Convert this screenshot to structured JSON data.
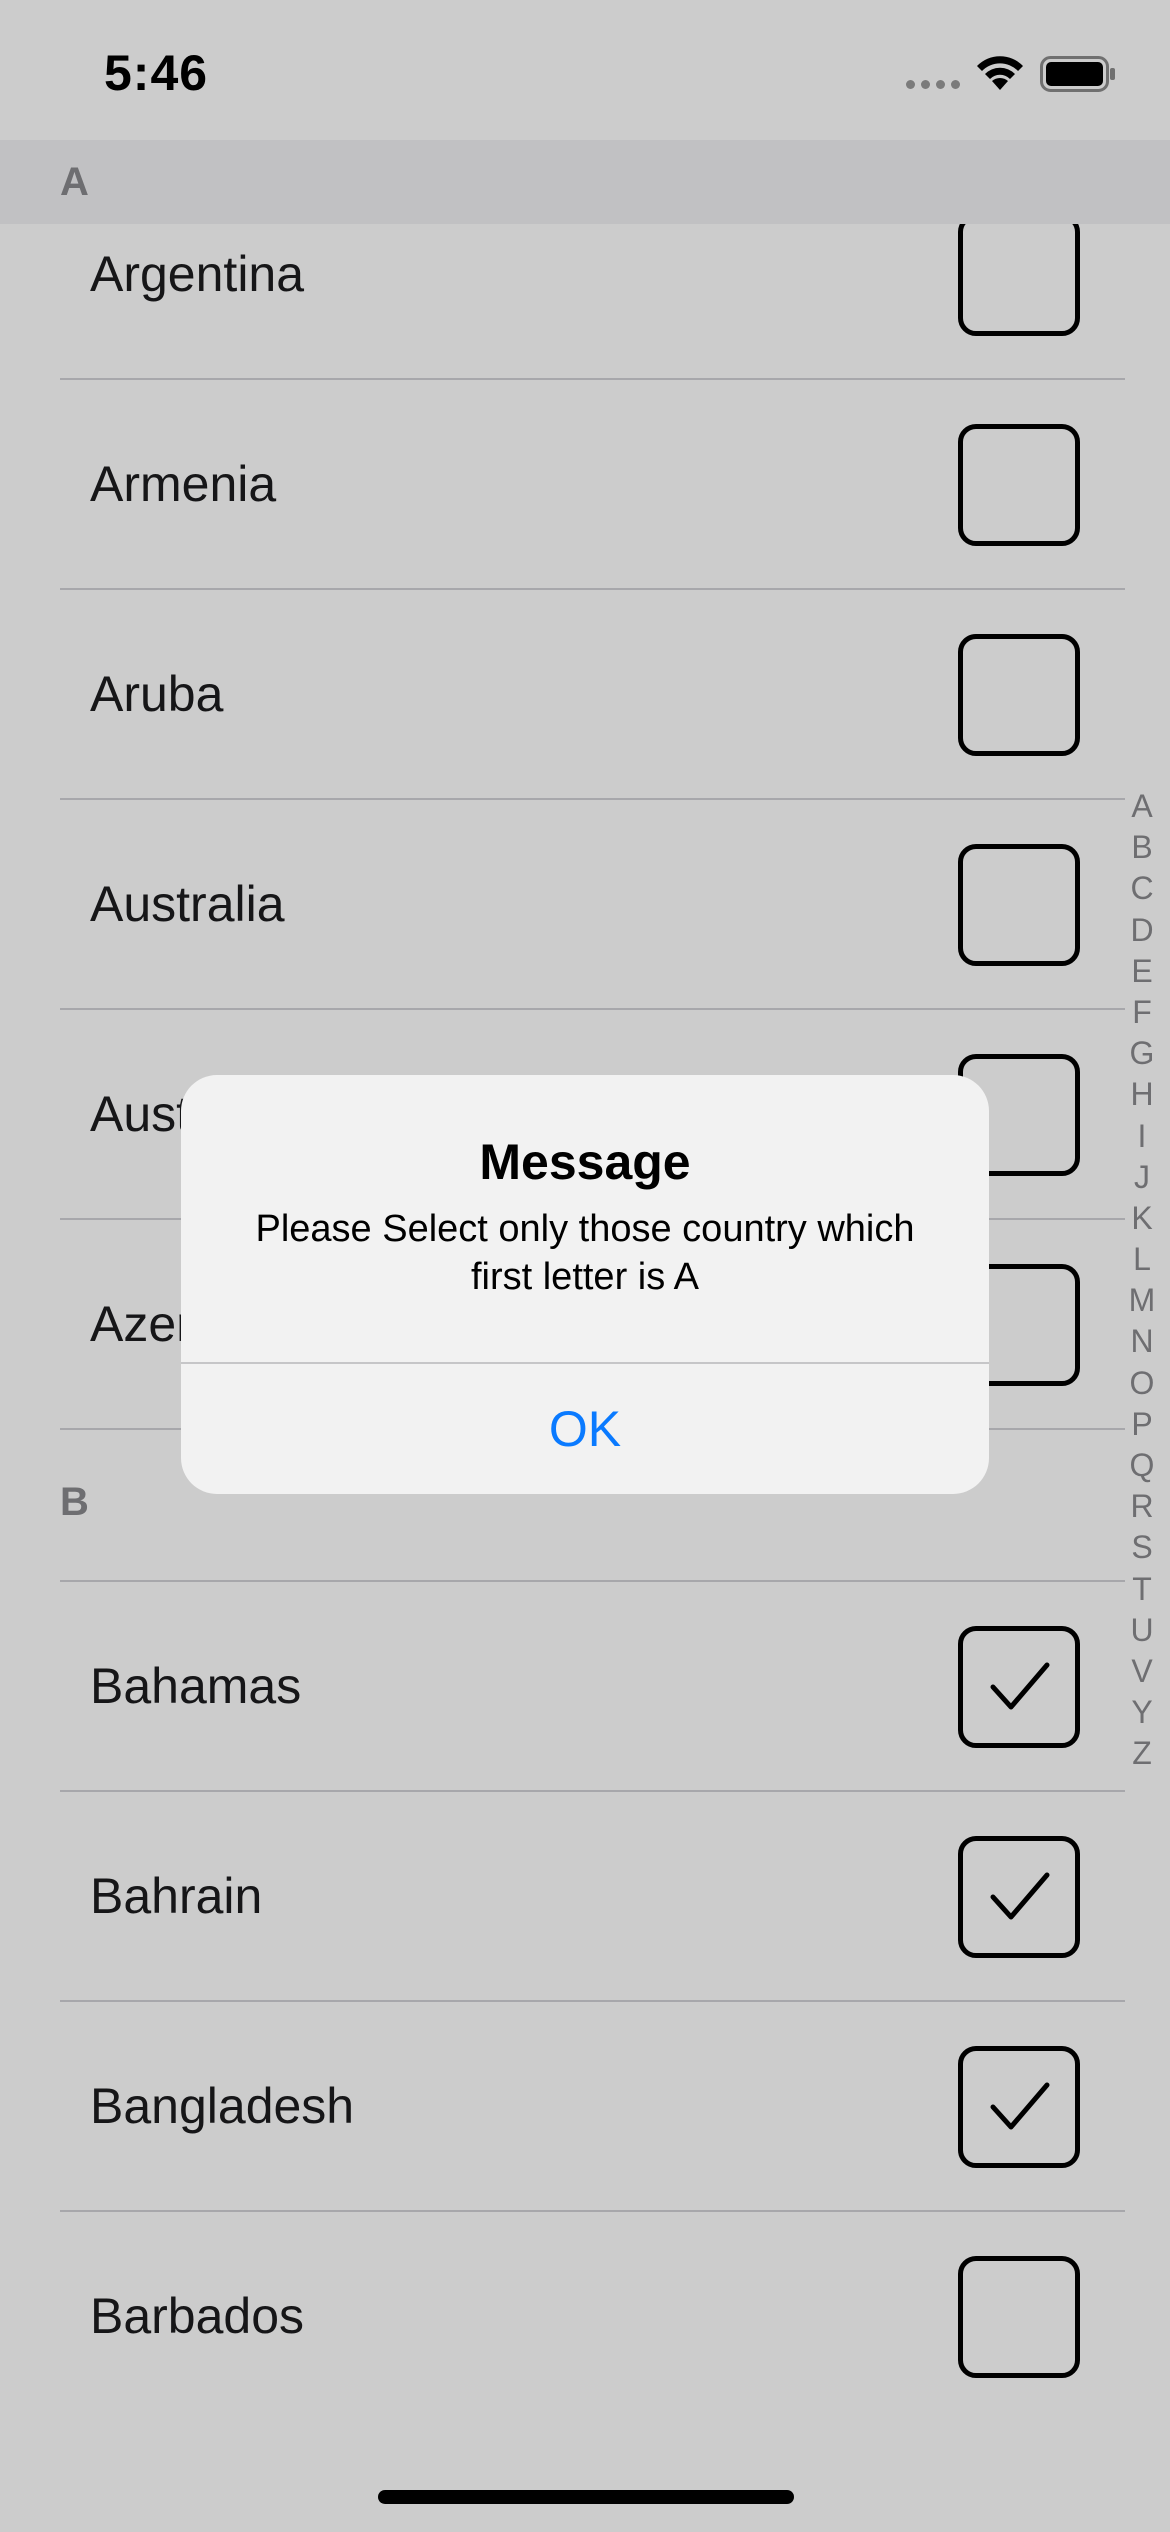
{
  "status_bar": {
    "time": "5:46"
  },
  "sections": [
    {
      "letter": "A",
      "rows": [
        {
          "label": "Argentina",
          "checked": false
        },
        {
          "label": "Armenia",
          "checked": false
        },
        {
          "label": "Aruba",
          "checked": false
        },
        {
          "label": "Australia",
          "checked": false
        },
        {
          "label": "Austria",
          "checked": false
        },
        {
          "label": "Azerbaijan",
          "checked": false
        }
      ]
    },
    {
      "letter": "B",
      "rows": [
        {
          "label": "Bahamas",
          "checked": true
        },
        {
          "label": "Bahrain",
          "checked": true
        },
        {
          "label": "Bangladesh",
          "checked": true
        },
        {
          "label": "Barbados",
          "checked": false
        }
      ]
    }
  ],
  "index_letters": [
    "A",
    "B",
    "C",
    "D",
    "E",
    "F",
    "G",
    "H",
    "I",
    "J",
    "K",
    "L",
    "M",
    "N",
    "O",
    "P",
    "Q",
    "R",
    "S",
    "T",
    "U",
    "V",
    "Y",
    "Z"
  ],
  "alert": {
    "title": "Message",
    "message": "Please Select only those country which first letter is A",
    "ok_label": "OK"
  },
  "colors": {
    "accent": "#0a7aff",
    "section_header_text": "#8a8a8e",
    "separator": "#d1d1d6"
  }
}
